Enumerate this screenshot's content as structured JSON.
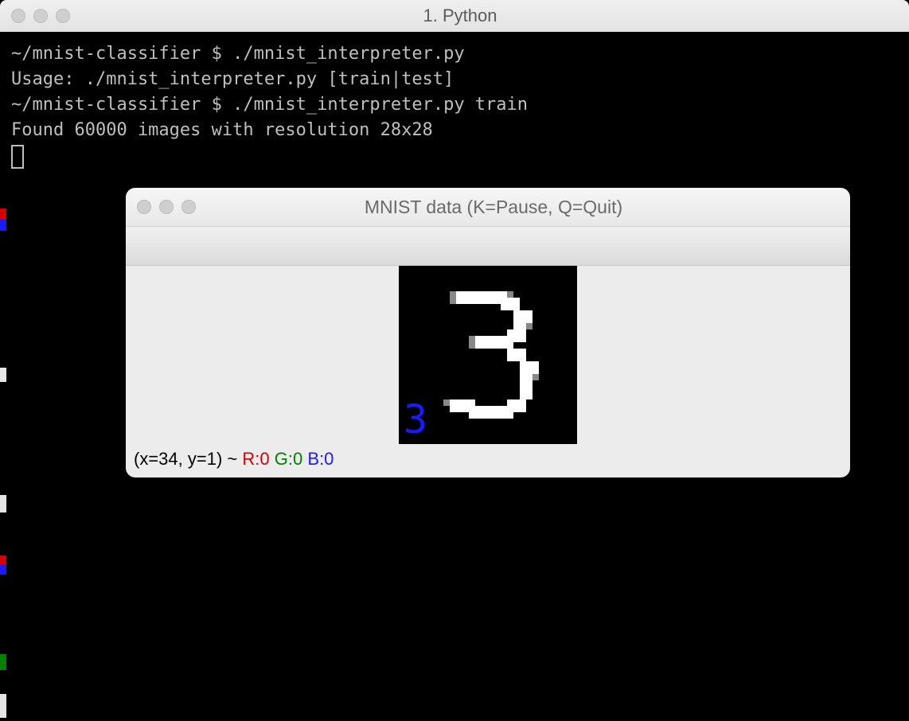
{
  "outer": {
    "title": "1. Python",
    "prompt_path": "~/mnist-classifier",
    "prompt_symbol": "$",
    "lines": {
      "cmd1": "./mnist_interpreter.py",
      "out1": "Usage: ./mnist_interpreter.py [train|test]",
      "cmd2": "./mnist_interpreter.py train",
      "out2": "Found 60000 images with resolution 28x28"
    }
  },
  "mnist": {
    "title": "MNIST data (K=Pause, Q=Quit)",
    "digit_label": "3",
    "status_prefix": "(x=34, y=1) ~ ",
    "r": "R:0",
    "g": "G:0",
    "b": "B:0"
  },
  "digit_glyph": "3",
  "colors": {
    "red": "#d40000",
    "green": "#008000",
    "blue": "#1a1aff"
  }
}
